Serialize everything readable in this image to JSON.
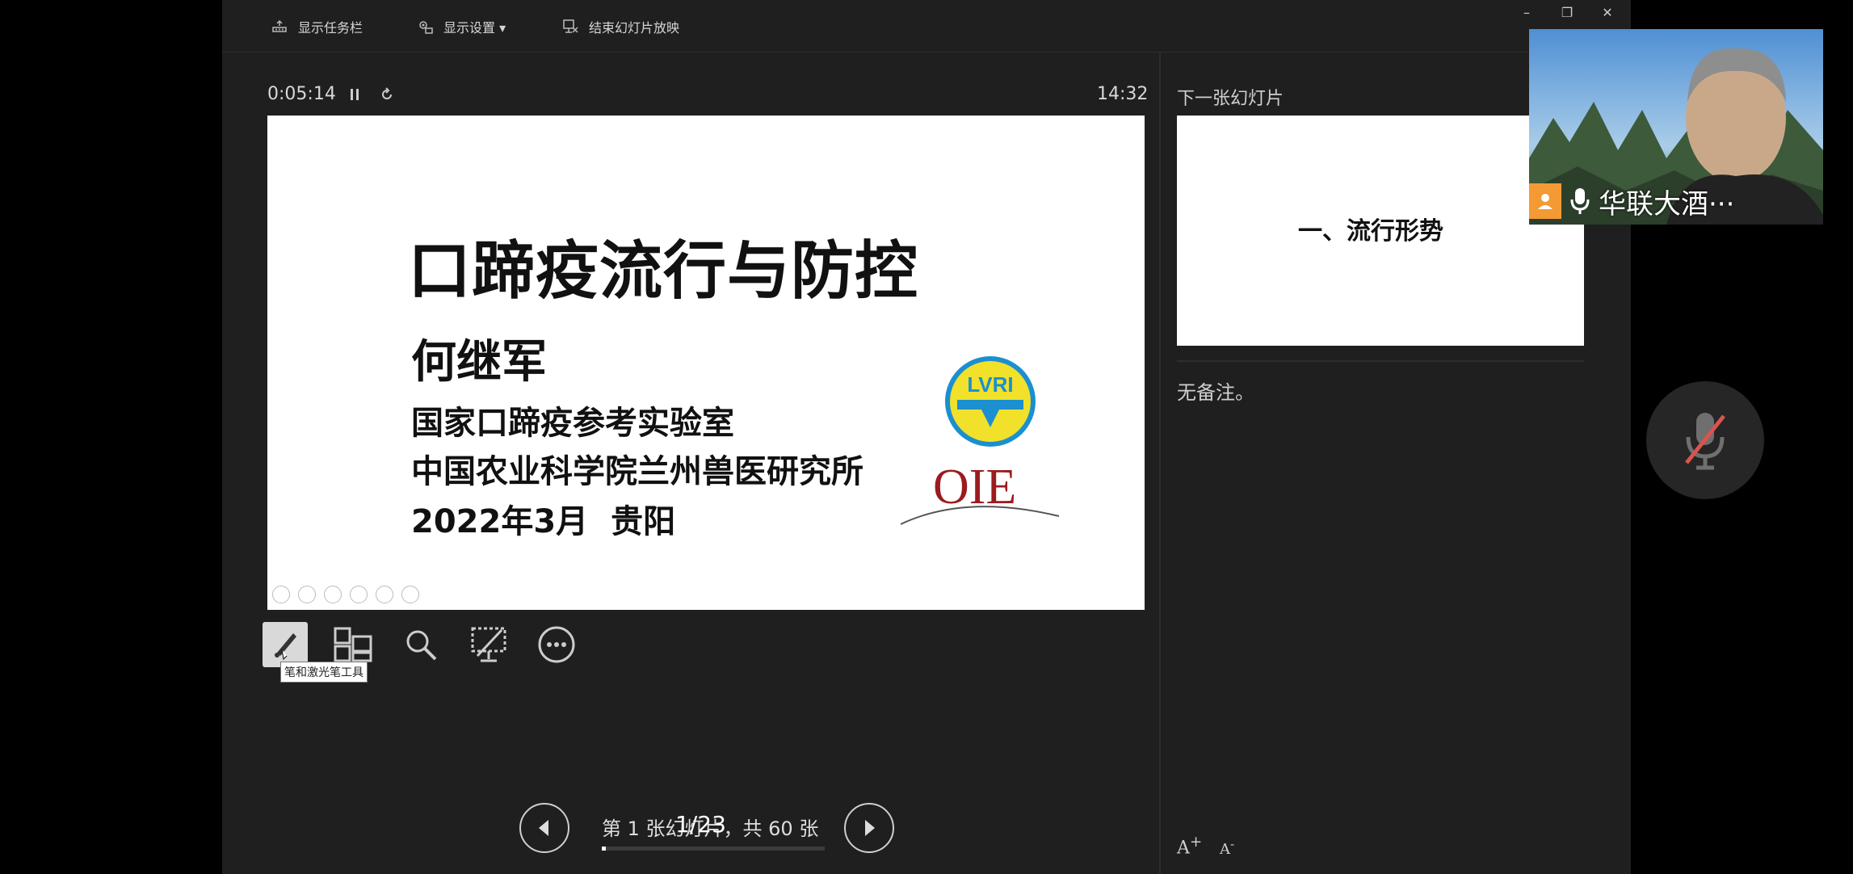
{
  "topbar": {
    "taskbar_label": "显示任务栏",
    "settings_label": "显示设置 ▾",
    "end_show_label": "结束幻灯片放映",
    "min_symbol": "–",
    "restore_symbol": "❐",
    "close_symbol": "✕"
  },
  "timer": {
    "elapsed": "0:05:14",
    "clock": "14:32"
  },
  "current_slide": {
    "title": "口蹄疫流行与防控",
    "author": "何继军",
    "affiliation_1": "国家口蹄疫参考实验室",
    "affiliation_2": "中国农业科学院兰州兽医研究所",
    "date": "2022年3月",
    "place": "贵阳",
    "logo_lvri_text": "LVRI",
    "logo_oie_text": "OIE"
  },
  "tools": {
    "pen_tooltip": "笔和激光笔工具"
  },
  "navigation": {
    "slide_label": "第 1 张幻灯片，共 60 张",
    "progress_fraction": 0.0167,
    "page_count": "1/23"
  },
  "next_panel": {
    "label": "下一张幻灯片",
    "next_slide_text": "一、流行形势",
    "notes": "无备注。",
    "font_up": "A",
    "font_down": "A"
  },
  "video": {
    "participant_name": "华联大酒···"
  },
  "colors": {
    "background": "#1f1f1f",
    "avatar": "#f39a34",
    "mic_muted": "#d9534f"
  }
}
